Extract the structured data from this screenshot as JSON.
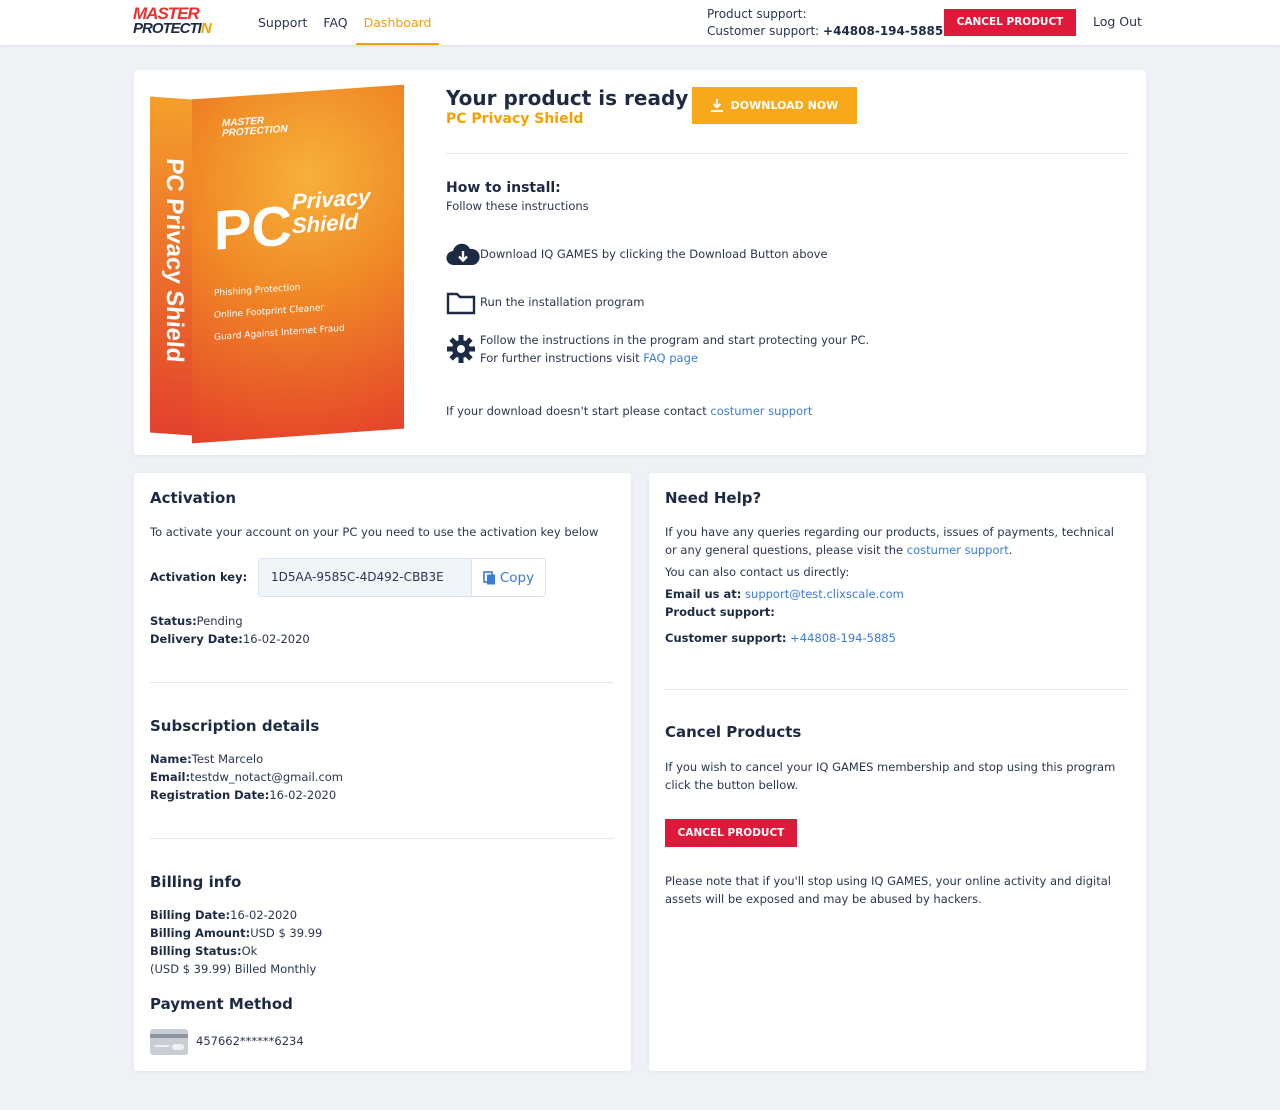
{
  "header": {
    "logo_line1": "MASTER",
    "logo_line2a": "PRO",
    "logo_line2b": "TECTI",
    "logo_line2c": "N",
    "nav": [
      {
        "label": "Support"
      },
      {
        "label": "FAQ"
      },
      {
        "label": "Dashboard"
      }
    ],
    "product_support_label": "Product support:",
    "customer_support_label": "Customer support:",
    "customer_support_phone": "+44808-194-5885",
    "cancel_label": "CANCEL PRODUCT",
    "logout_label": "Log Out"
  },
  "product": {
    "box_brand1": "MASTER",
    "box_brand2": "PROTECTION",
    "box_pc": "PC",
    "box_name1": "Privacy",
    "box_name2": "Shield",
    "box_side": "PC Privacy Shield",
    "box_features": [
      "Phishing Protection",
      "Online Footprint Cleaner",
      "Guard Against Internet Fraud"
    ],
    "ready_title": "Your product is ready",
    "product_name": "PC Privacy Shield",
    "download_label": "DOWNLOAD NOW",
    "howto_title": "How to install:",
    "howto_sub": "Follow these instructions",
    "step1": "Download IQ GAMES by clicking the Download Button above",
    "step2": "Run the installation program",
    "step3_line1": "Follow the instructions in the program and start protecting your PC.",
    "step3_line2": "For further instructions visit ",
    "step3_link": "FAQ page",
    "contact_text": "If your download doesn't start please contact ",
    "contact_link": "costumer support"
  },
  "activation": {
    "title": "Activation",
    "desc": "To activate your account on your PC you need to use the activation key below",
    "key_label": "Activation key:",
    "key_value": "1D5AA-9585C-4D492-CBB3E",
    "copy_label": "Copy",
    "status_label": "Status:",
    "status_value": "Pending",
    "delivery_label": "Delivery Date:",
    "delivery_value": "16-02-2020"
  },
  "subscription": {
    "title": "Subscription details",
    "name_label": "Name:",
    "name_value": "Test Marcelo",
    "email_label": "Email:",
    "email_value": "testdw_notact@gmail.com",
    "reg_label": "Registration Date:",
    "reg_value": "16-02-2020"
  },
  "billing": {
    "title": "Billing info",
    "date_label": "Billing Date:",
    "date_value": "16-02-2020",
    "amount_label": "Billing Amount:",
    "amount_value": "USD $ 39.99",
    "status_label": "Billing Status:",
    "status_value": "Ok",
    "recurring": "(USD $ 39.99) Billed Monthly"
  },
  "payment": {
    "title": "Payment Method",
    "card_number": "457662******6234"
  },
  "help": {
    "title": "Need Help?",
    "line1": "If you have any queries regarding our products, issues of payments, technical",
    "line2": "or any general questions, please visit the ",
    "line2_link": "costumer support",
    "line2_end": ".",
    "line3": "You can also contact us directly:",
    "email_label": "Email us at:",
    "email_value": "support@test.clixscale.com",
    "product_support_label": "Product support:",
    "customer_support_label": "Customer support:",
    "customer_support_phone": "+44808-194-5885"
  },
  "cancel": {
    "title": "Cancel Products",
    "line1": "If you wish to cancel your IQ GAMES membership and stop using this program",
    "line2": "click the button bellow.",
    "button_label": "CANCEL PRODUCT",
    "note1": "Please note that if you'll stop using IQ GAMES, your online activity and digital",
    "note2": "assets will be exposed and may be abused by hackers."
  },
  "colors": {
    "accent": "#f5a100",
    "danger": "#dd1a3a",
    "link": "#3a7bd5",
    "text_dark": "#1d2a44"
  }
}
